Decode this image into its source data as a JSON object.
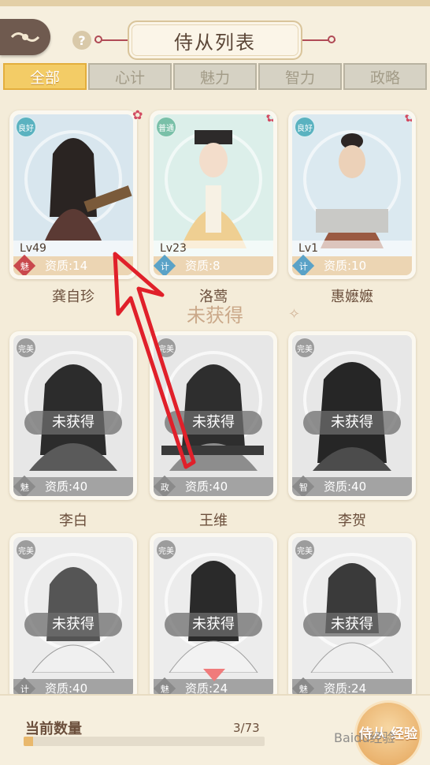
{
  "header": {
    "title": "侍从列表",
    "help_label": "?"
  },
  "tabs": [
    {
      "label": "全部",
      "active": true
    },
    {
      "label": "心计",
      "active": false
    },
    {
      "label": "魅力",
      "active": false
    },
    {
      "label": "智力",
      "active": false
    },
    {
      "label": "政略",
      "active": false
    }
  ],
  "owned": [
    {
      "name": "龚自珍",
      "rarity": "良好",
      "level": "Lv49",
      "attr": "魅",
      "quality": "资质:14",
      "bg": "#d8e6ee",
      "attr_color": "#c9484d"
    },
    {
      "name": "洛莺",
      "rarity": "普通",
      "level": "Lv23",
      "attr": "计",
      "quality": "资质:8",
      "bg": "#dcefea",
      "attr_color": "#5aa2c7"
    },
    {
      "name": "惠嬷嬷",
      "rarity": "良好",
      "level": "Lv1",
      "attr": "计",
      "quality": "资质:10",
      "bg": "#dbe9f0",
      "attr_color": "#5aa2c7"
    }
  ],
  "divider_label": "未获得",
  "locked": [
    {
      "name": "李白",
      "rarity": "完美",
      "attr": "魅",
      "quality": "资质:40",
      "status": "未获得"
    },
    {
      "name": "王维",
      "rarity": "完美",
      "attr": "政",
      "quality": "资质:40",
      "status": "未获得"
    },
    {
      "name": "李贺",
      "rarity": "完美",
      "attr": "智",
      "quality": "资质:40",
      "status": "未获得"
    },
    {
      "name": "",
      "rarity": "完美",
      "attr": "计",
      "quality": "资质:40",
      "status": "未获得"
    },
    {
      "name": "",
      "rarity": "完美",
      "attr": "魅",
      "quality": "资质:24",
      "status": "未获得"
    },
    {
      "name": "",
      "rarity": "完美",
      "attr": "魅",
      "quality": "资质:24",
      "status": "未获得"
    }
  ],
  "footer": {
    "count_label": "当前数量",
    "count_value": "3/73",
    "progress": 0.04,
    "gain_button": "侍从 经验",
    "watermark": "Baidu经验"
  },
  "colors": {
    "accent": "#f3cc66",
    "title_red": "#b04a56",
    "rare_badge": "#5ab2c0"
  }
}
